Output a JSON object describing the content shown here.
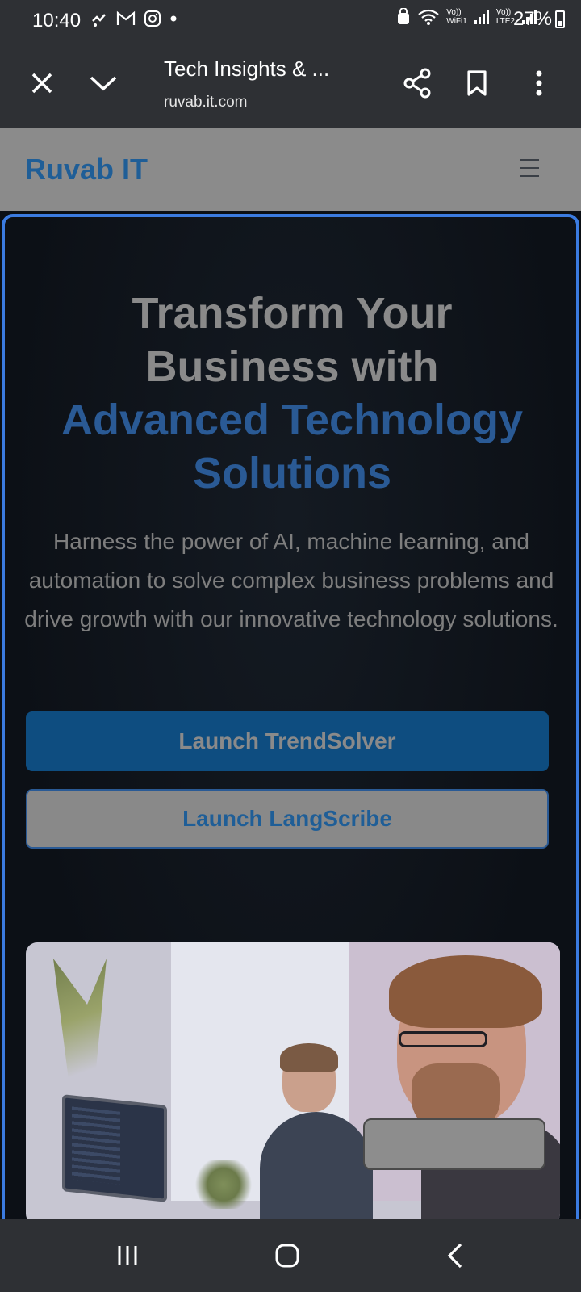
{
  "status_bar": {
    "time": "10:40",
    "left_icons": [
      "missed-call-icon",
      "gmail-icon",
      "instagram-icon",
      "dot-icon"
    ],
    "right_icons": [
      "security-icon",
      "wifi-icon",
      "vowifi-label",
      "signal-icon",
      "volte-label",
      "signal-icon"
    ],
    "vowifi_label": "Vo))\nWiFi1",
    "volte_label": "Vo))\nLTE2",
    "battery": "27%"
  },
  "browser": {
    "page_title": "Tech Insights & ...",
    "url": "ruvab.it.com",
    "actions": [
      "close-icon",
      "collapse-icon",
      "share-icon",
      "bookmark-icon",
      "more-icon"
    ]
  },
  "site": {
    "brand": "Ruvab IT",
    "menu_icon": "hamburger-icon"
  },
  "hero": {
    "title_line1": "Transform Your",
    "title_line2": "Business with",
    "title_line3": "Advanced Technology",
    "title_line4": "Solutions",
    "description": "Harness the power of AI, machine learning, and automation to solve complex business problems and drive growth with our innovative technology solutions.",
    "primary_button": "Launch TrendSolver",
    "secondary_button": "Launch LangScribe"
  },
  "colors": {
    "accent_blue": "#1f5e97",
    "hero_border": "#3b7be0",
    "primary_button": "#0e4d80"
  },
  "nav": {
    "buttons": [
      "recent-apps-icon",
      "home-icon",
      "back-icon"
    ]
  }
}
